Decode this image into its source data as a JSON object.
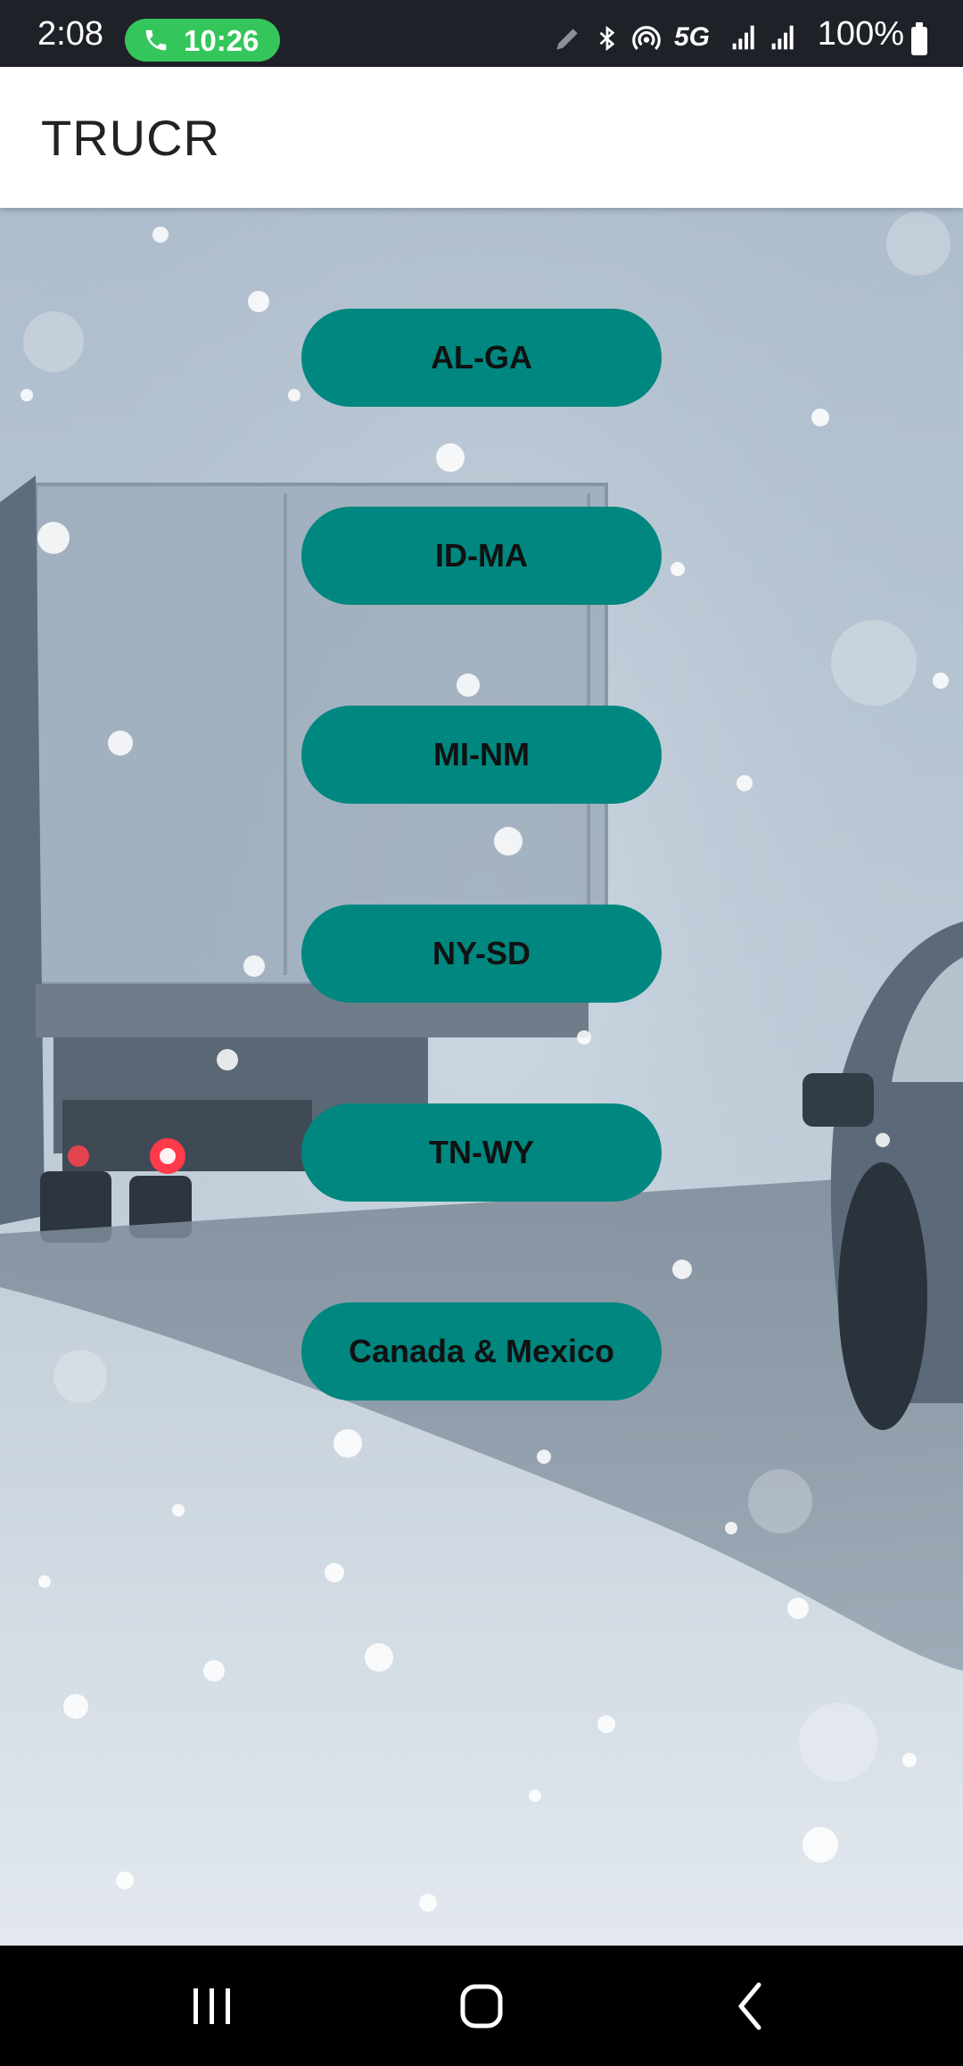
{
  "status_bar": {
    "time": "2:08",
    "call_duration": "10:26",
    "network": "5G",
    "battery": "100%",
    "icons": [
      "pen-icon",
      "bluetooth-icon",
      "hotspot-icon",
      "5g-icon",
      "signal-icon",
      "signal-icon-2",
      "battery-icon"
    ]
  },
  "app_bar": {
    "title": "TRUCR"
  },
  "regions": [
    {
      "label": "AL-GA"
    },
    {
      "label": "ID-MA"
    },
    {
      "label": "MI-NM"
    },
    {
      "label": "NY-SD"
    },
    {
      "label": "TN-WY"
    },
    {
      "label": "Canada & Mexico"
    }
  ],
  "colors": {
    "accent": "#00877f",
    "call_pill": "#34c65a",
    "status_bar": "#1e2128"
  },
  "nav_bar": {
    "buttons": [
      "recent-apps-icon",
      "home-icon",
      "back-icon"
    ]
  }
}
